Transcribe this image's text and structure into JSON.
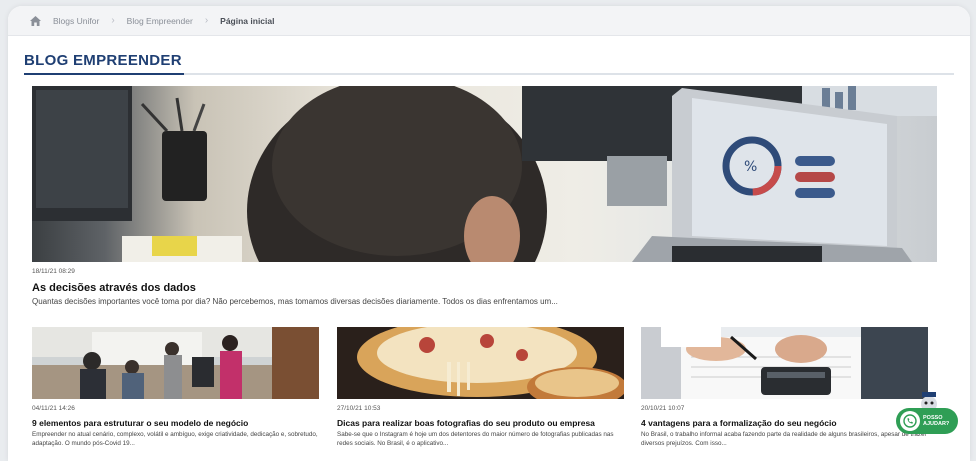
{
  "breadcrumb": {
    "items": [
      "Blogs Unifor",
      "Blog Empreender"
    ],
    "current": "Página inicial"
  },
  "blog": {
    "title": "BLOG EMPREENDER"
  },
  "featured": {
    "date": "18/11/21 08:29",
    "title": "As decisões através dos dados",
    "excerpt": "Quantas decisões importantes você toma por dia? Não percebemos, mas tomamos diversas decisões diariamente. Todos os dias enfrentamos um..."
  },
  "posts": [
    {
      "date": "04/11/21 14:26",
      "title": "9 elementos para estruturar o seu modelo de negócio",
      "excerpt": "Empreender no atual cenário, complexo, volátil e ambíguo, exige criatividade, dedicação e, sobretudo, adaptação. O mundo pós-Covid 19..."
    },
    {
      "date": "27/10/21 10:53",
      "title": "Dicas para realizar boas fotografias do seu produto ou empresa",
      "excerpt": "Sabe-se que o Instagram é hoje um dos detentores do maior número de fotografias publicadas nas redes sociais. No Brasil, é o aplicativo..."
    },
    {
      "date": "20/10/21 10:07",
      "title": "4 vantagens para a formalização do seu negócio",
      "excerpt": "No Brasil, o trabalho informal acaba fazendo parte da realidade de alguns brasileiros, apesar de trazer diversos prejuízos. Com isso..."
    }
  ],
  "whatsapp": {
    "label_line1": "POSSO",
    "label_line2": "AJUDAR?"
  },
  "colors": {
    "brand": "#1f3f73",
    "whatsapp_green": "#2f9e55"
  },
  "icons": {
    "home": "home-icon",
    "separator": "chevron-right-icon",
    "whatsapp": "whatsapp-icon"
  }
}
